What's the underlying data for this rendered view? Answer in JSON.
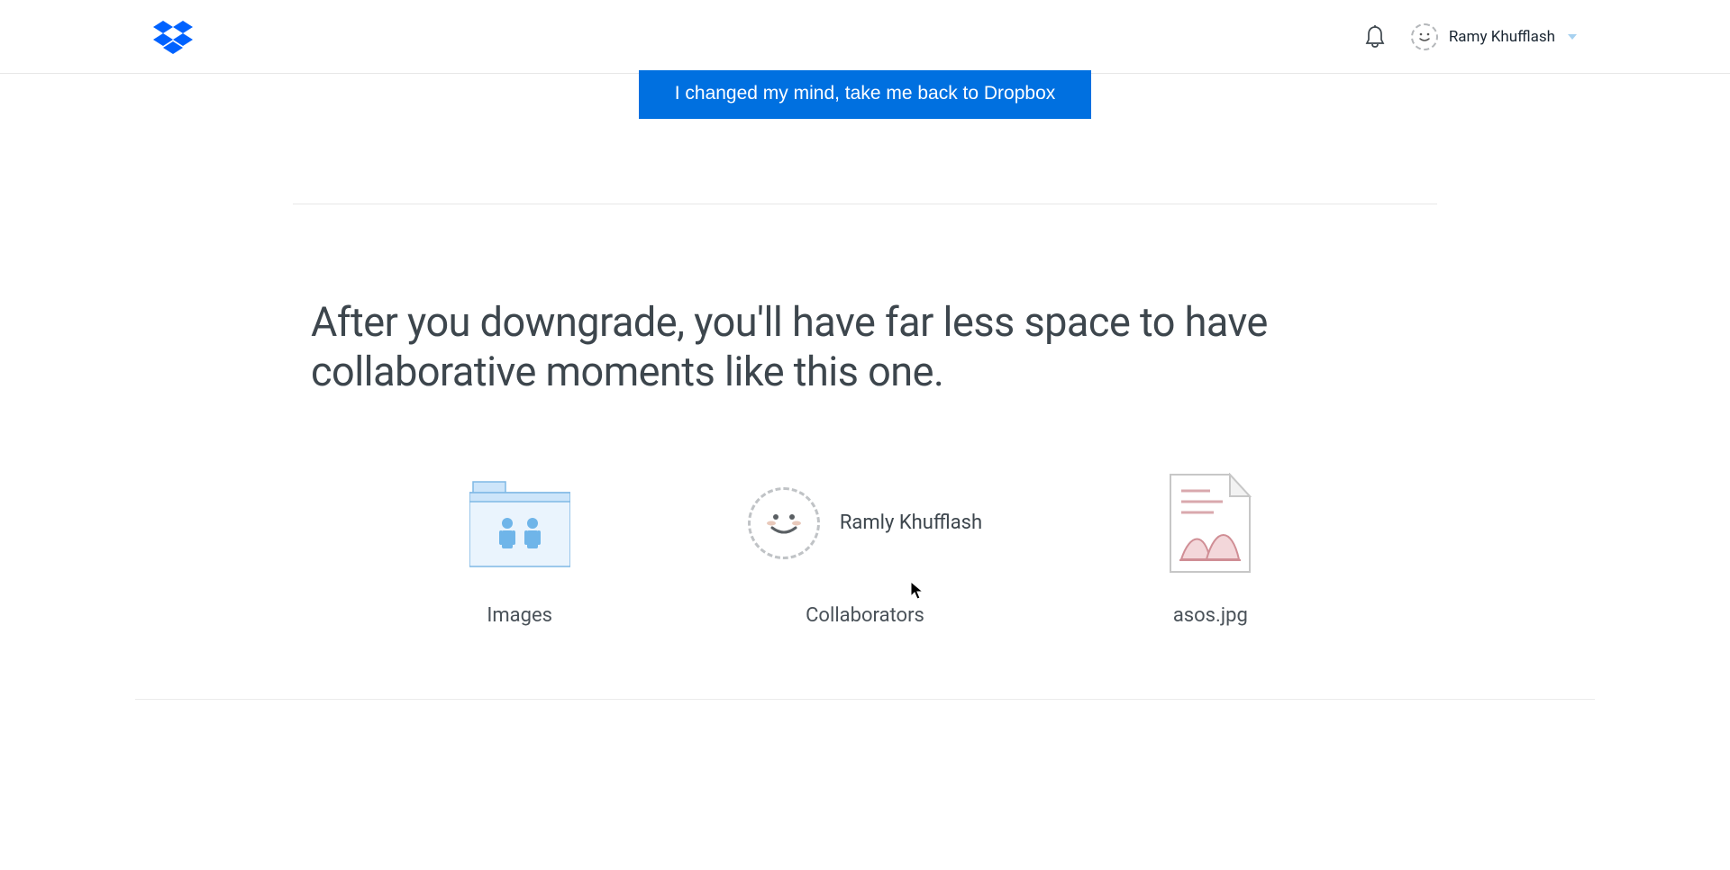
{
  "header": {
    "user_name": "Ramy Khufflash"
  },
  "cta": {
    "label": "I changed my mind, take me back to Dropbox"
  },
  "headline": "After you downgrade, you'll have far less space to have collaborative moments like this one.",
  "items": {
    "folder_label": "Images",
    "collab_label": "Collaborators",
    "collab_name": "Ramly Khufflash",
    "file_label": "asos.jpg"
  }
}
